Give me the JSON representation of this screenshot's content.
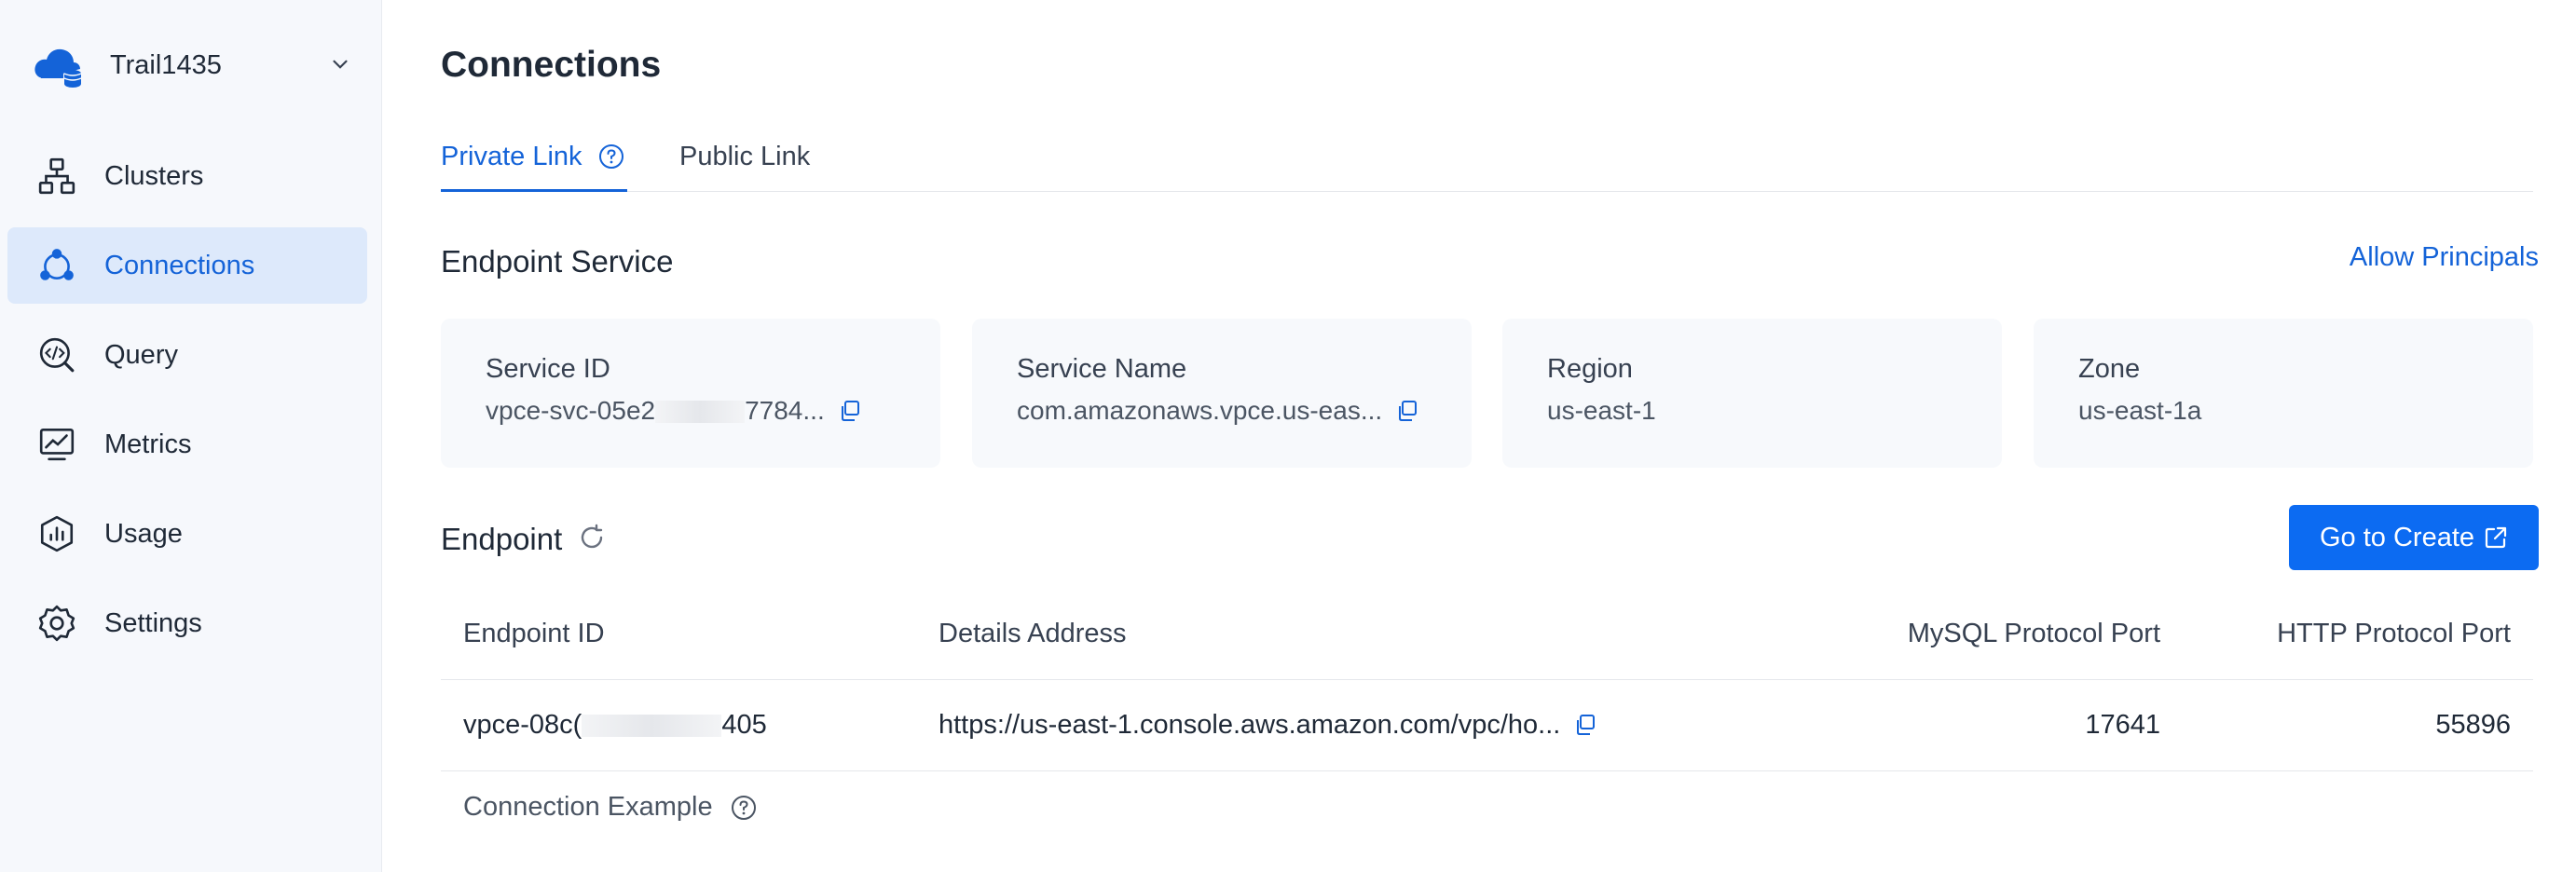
{
  "sidebar": {
    "org_name": "Trail1435",
    "items": [
      {
        "label": "Clusters",
        "icon": "clusters-icon"
      },
      {
        "label": "Connections",
        "icon": "connections-icon",
        "active": true
      },
      {
        "label": "Query",
        "icon": "query-icon"
      },
      {
        "label": "Metrics",
        "icon": "metrics-icon"
      },
      {
        "label": "Usage",
        "icon": "usage-icon"
      },
      {
        "label": "Settings",
        "icon": "settings-icon"
      }
    ]
  },
  "main": {
    "title": "Connections",
    "tabs": [
      {
        "label": "Private Link",
        "active": true
      },
      {
        "label": "Public Link",
        "active": false
      }
    ],
    "endpoint_service": {
      "title": "Endpoint Service",
      "allow_principals": "Allow Principals",
      "cards": [
        {
          "key": "Service ID",
          "value_prefix": "vpce-svc-05e2",
          "value_suffix": "7784..."
        },
        {
          "key": "Service Name",
          "value": "com.amazonaws.vpce.us-eas..."
        },
        {
          "key": "Region",
          "value": "us-east-1"
        },
        {
          "key": "Zone",
          "value": "us-east-1a"
        }
      ]
    },
    "endpoint": {
      "title": "Endpoint",
      "create_button": "Go to Create",
      "columns": [
        "Endpoint ID",
        "Details Address",
        "MySQL Protocol Port",
        "HTTP Protocol Port"
      ],
      "rows": [
        {
          "endpoint_id_prefix": "vpce-08c(",
          "endpoint_id_suffix": "405",
          "address": "https://us-east-1.console.aws.amazon.com/vpc/ho...",
          "mysql_port": "17641",
          "http_port": "55896"
        }
      ],
      "example_label": "Connection Example"
    }
  },
  "colors": {
    "accent": "#1463d8",
    "button": "#0c6bf2",
    "sidebar_bg": "#f6f8fc",
    "active_bg": "#dde9fb"
  }
}
